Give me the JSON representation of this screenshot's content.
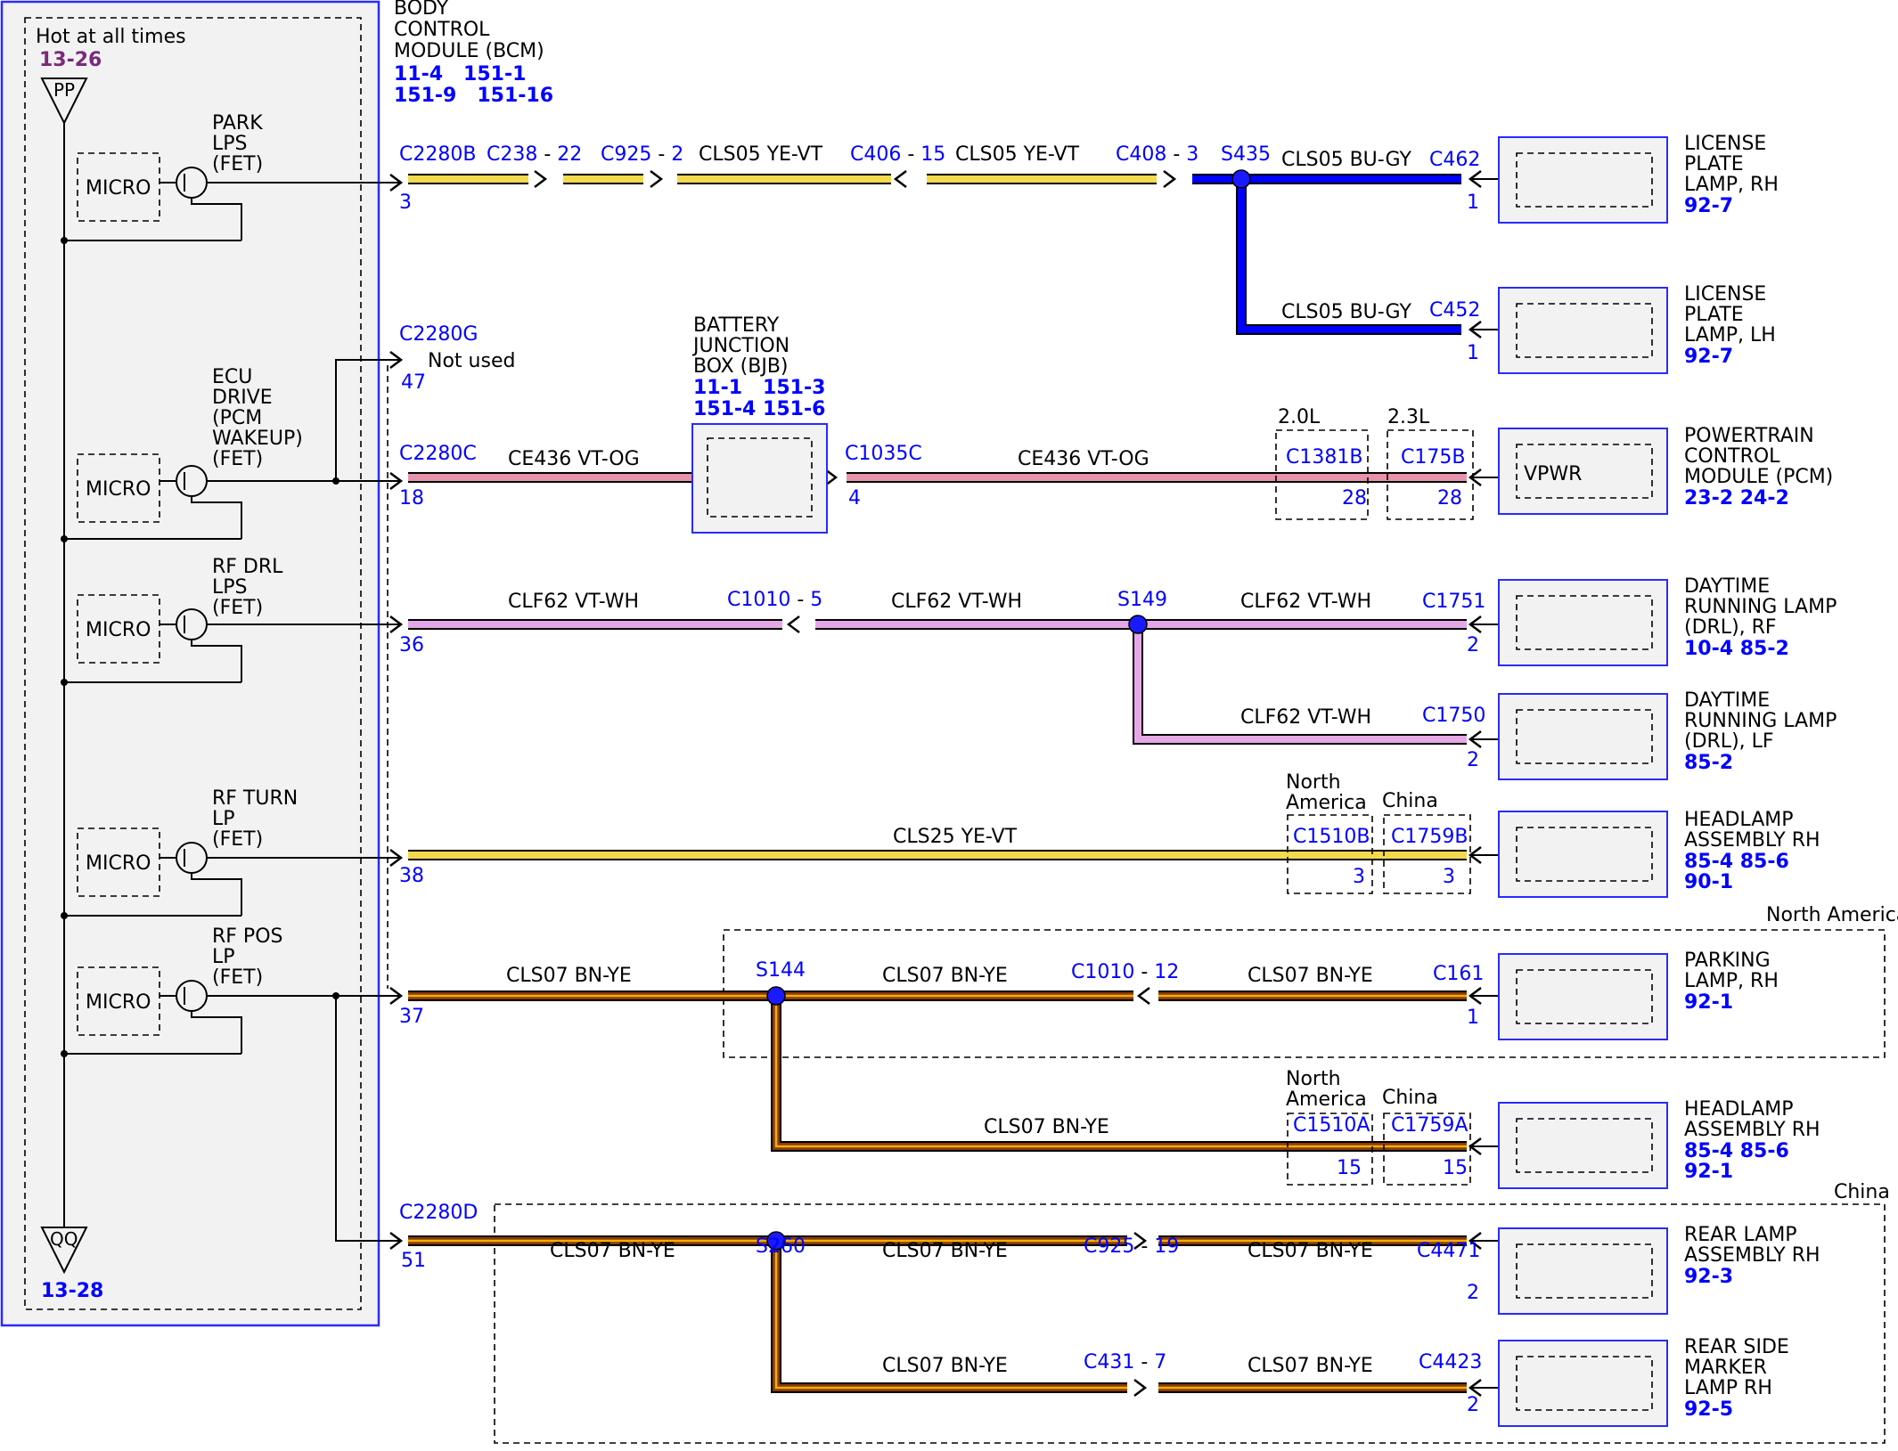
{
  "colors": {
    "blue": "#0000ff",
    "yellow": "#f2d94e",
    "pink": "#e893ac",
    "violet": "#e5a8e6",
    "brown": "#8b3a0e",
    "brown_stripe": "#f0b000",
    "panel": "#f2f2f2",
    "purple_ref": "#7a2a7a"
  },
  "bcm": {
    "title_lines": [
      "BODY",
      "CONTROL",
      "MODULE (BCM)"
    ],
    "ref_lines": [
      "11-4   151-1",
      "151-9   151-16"
    ],
    "hot_label": "Hot at all times",
    "pp_ref": "13-26",
    "pp_label": "PP",
    "qq_label": "QQ",
    "qq_ref": "13-28",
    "micro_label": "MICRO",
    "drivers": [
      {
        "lines": [
          "PARK",
          "LPS",
          "(FET)"
        ]
      },
      {
        "lines": [
          "ECU",
          "DRIVE",
          "(PCM",
          "WAKEUP)",
          "(FET)"
        ]
      },
      {
        "lines": [
          "RF DRL",
          "LPS",
          "(FET)"
        ]
      },
      {
        "lines": [
          "RF TURN",
          "LP",
          "(FET)"
        ]
      },
      {
        "lines": [
          "RF POS",
          "LP",
          "(FET)"
        ]
      }
    ]
  },
  "not_used": {
    "connector": "C2280G",
    "pin": "47",
    "label": "Not used"
  },
  "bjb": {
    "title_lines": [
      "BATTERY",
      "JUNCTION",
      "BOX (BJB)"
    ],
    "ref_lines": [
      "11-1   151-3",
      "151-4 151-6"
    ]
  },
  "components": [
    {
      "lines": [
        "LICENSE",
        "PLATE",
        "LAMP, RH"
      ],
      "refs": [
        "92-7"
      ]
    },
    {
      "lines": [
        "LICENSE",
        "PLATE",
        "LAMP, LH"
      ],
      "refs": [
        "92-7"
      ]
    },
    {
      "lines": [
        "POWERTRAIN",
        "CONTROL",
        "MODULE (PCM)"
      ],
      "refs": [
        "23-2   24-2"
      ],
      "inner": "VPWR"
    },
    {
      "lines": [
        "DAYTIME",
        "RUNNING LAMP",
        "(DRL), RF"
      ],
      "refs": [
        "10-4   85-2"
      ]
    },
    {
      "lines": [
        "DAYTIME",
        "RUNNING LAMP",
        "(DRL), LF"
      ],
      "refs": [
        "85-2"
      ]
    },
    {
      "lines": [
        "HEADLAMP",
        "ASSEMBLY RH"
      ],
      "refs": [
        "85-4   85-6",
        "90-1"
      ]
    },
    {
      "lines": [
        "PARKING",
        "LAMP, RH"
      ],
      "refs": [
        "92-1"
      ]
    },
    {
      "lines": [
        "HEADLAMP",
        "ASSEMBLY RH"
      ],
      "refs": [
        "85-4   85-6",
        "92-1"
      ]
    },
    {
      "lines": [
        "REAR LAMP",
        "ASSEMBLY RH"
      ],
      "refs": [
        "92-3"
      ]
    },
    {
      "lines": [
        "REAR SIDE",
        "MARKER",
        "LAMP RH"
      ],
      "refs": [
        "92-5"
      ]
    }
  ],
  "option_labels": {
    "engine_a": "2.0L",
    "engine_b": "2.3L",
    "north_america_lines": [
      "North",
      "America"
    ],
    "china": "China",
    "region_north_america": "North America",
    "region_china": "China"
  },
  "circuits": [
    {
      "id": "park-lps",
      "rows": [
        {
          "text": "C2280B",
          "pin": "3"
        },
        {
          "text": "C238 - 22"
        },
        {
          "text": "C925 - 2"
        },
        {
          "text": "CLS05   YE-VT"
        },
        {
          "text": "C406 - 15"
        },
        {
          "text": "CLS05   YE-VT"
        },
        {
          "text": "C408 - 3"
        },
        {
          "text": "S435"
        },
        {
          "text": "CLS05   BU-GY"
        },
        {
          "text": "C462",
          "pin": "1"
        },
        {
          "text": "CLS05   BU-GY"
        },
        {
          "text": "C452",
          "pin": "1"
        }
      ]
    },
    {
      "id": "ecu-drive",
      "rows": [
        {
          "text": "C2280C",
          "pin": "18"
        },
        {
          "text": "CE436   VT-OG"
        },
        {
          "text": "C1035C",
          "pin": "4"
        },
        {
          "text": "CE436   VT-OG"
        },
        {
          "text": "C1381B",
          "pin": "28"
        },
        {
          "text": "C175B",
          "pin": "28"
        }
      ]
    },
    {
      "id": "rf-drl",
      "rows": [
        {
          "text": "36"
        },
        {
          "text": "CLF62   VT-WH"
        },
        {
          "text": "C1010 - 5"
        },
        {
          "text": "CLF62   VT-WH"
        },
        {
          "text": "S149"
        },
        {
          "text": "CLF62   VT-WH"
        },
        {
          "text": "C1751",
          "pin": "2"
        },
        {
          "text": "CLF62   VT-WH"
        },
        {
          "text": "C1750",
          "pin": "2"
        }
      ]
    },
    {
      "id": "rf-turn",
      "rows": [
        {
          "text": "38"
        },
        {
          "text": "CLS25   YE-VT"
        },
        {
          "text": "C1510B",
          "pin": "3"
        },
        {
          "text": "C1759B",
          "pin": "3"
        }
      ]
    },
    {
      "id": "rf-pos",
      "rows": [
        {
          "text": "37"
        },
        {
          "text": "CLS07   BN-YE"
        },
        {
          "text": "S144"
        },
        {
          "text": "CLS07   BN-YE"
        },
        {
          "text": "C1010 - 12"
        },
        {
          "text": "CLS07   BN-YE"
        },
        {
          "text": "C161",
          "pin": "1"
        },
        {
          "text": "CLS07   BN-YE"
        },
        {
          "text": "C1510A",
          "pin": "15"
        },
        {
          "text": "C1759A",
          "pin": "15"
        },
        {
          "text": "C2280D",
          "pin": "51"
        },
        {
          "text": "CLS07   BN-YE"
        },
        {
          "text": "S260"
        },
        {
          "text": "CLS07   BN-YE"
        },
        {
          "text": "C925 - 19"
        },
        {
          "text": "CLS07   BN-YE"
        },
        {
          "text": "C4471",
          "pin": "2"
        },
        {
          "text": "CLS07   BN-YE"
        },
        {
          "text": "C431 - 7"
        },
        {
          "text": "CLS07   BN-YE"
        },
        {
          "text": "C4423",
          "pin": "2"
        }
      ]
    }
  ]
}
